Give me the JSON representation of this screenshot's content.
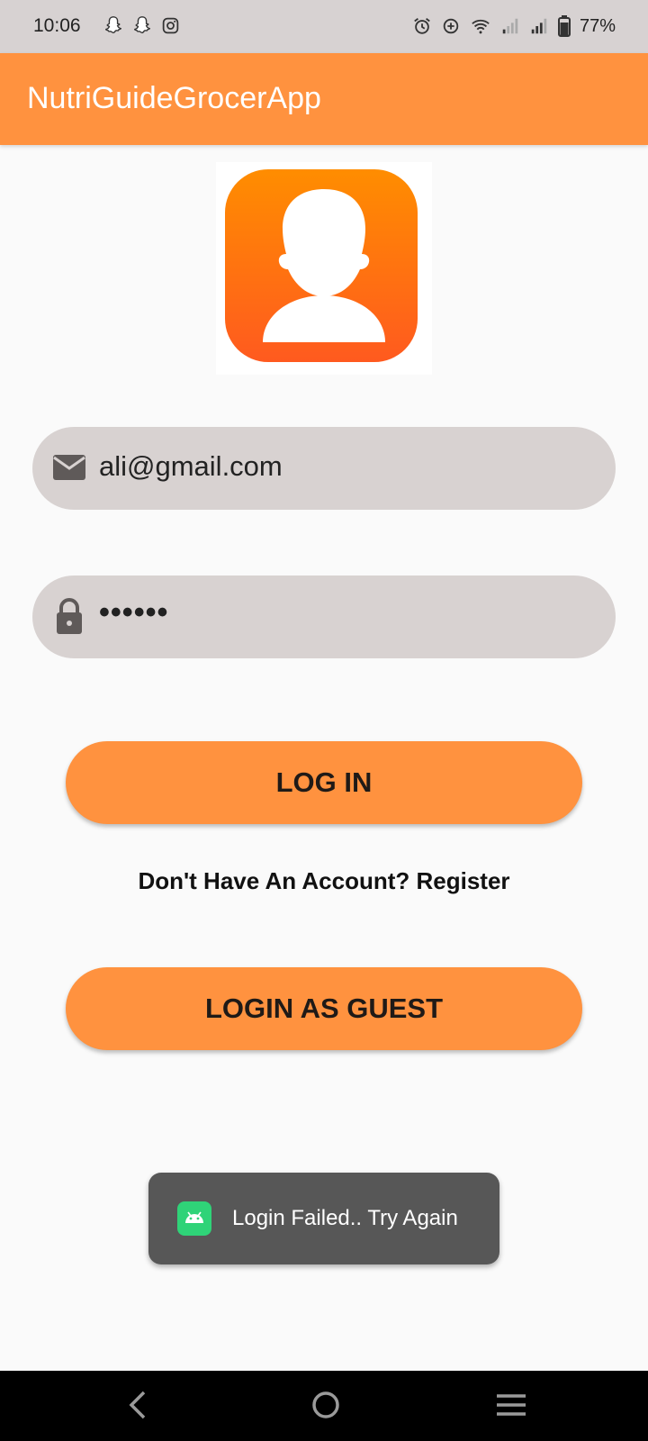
{
  "status_bar": {
    "time": "10:06",
    "notification_icons": [
      "snapchat-icon",
      "snapchat-icon",
      "instagram-icon"
    ],
    "system_icons": [
      "alarm-icon",
      "data-saver-icon",
      "wifi-icon",
      "signal-icon",
      "signal-icon",
      "battery-icon"
    ],
    "battery_percent": "77%"
  },
  "app_bar": {
    "title": "NutriGuideGrocerApp"
  },
  "logo": {
    "icon": "user-avatar-icon"
  },
  "login_form": {
    "email": {
      "icon": "mail-icon",
      "value": "ali@gmail.com"
    },
    "password": {
      "icon": "lock-icon",
      "masked_value": "••••••"
    },
    "login_button": "LOG IN",
    "register_link": "Don't Have An Account? Register",
    "guest_button": "LOGIN AS GUEST"
  },
  "toast": {
    "icon": "android-icon",
    "message": "Login Failed.. Try Again"
  },
  "nav_bar": {
    "buttons": [
      "back-icon",
      "home-icon",
      "recents-icon"
    ]
  },
  "colors": {
    "accent": "#ff923f",
    "status_bar": "#d7d2d2",
    "field_bg": "#d8d2d1",
    "toast_bg": "#575757",
    "toast_icon": "#2fd378"
  }
}
